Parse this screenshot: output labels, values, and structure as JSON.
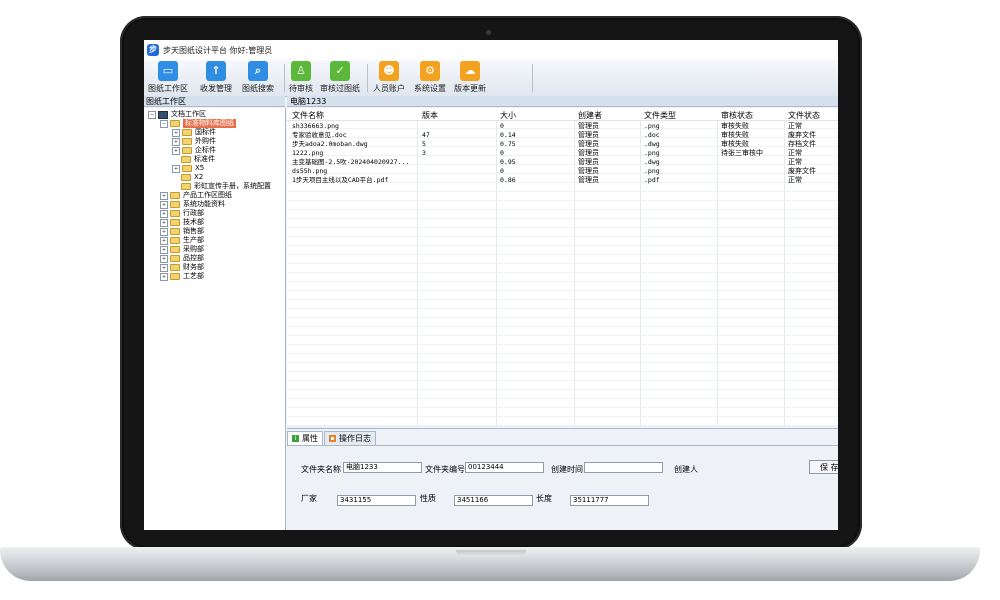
{
  "window": {
    "title": "步天图纸设计平台 你好:管理员"
  },
  "toolbar": {
    "buttons": [
      {
        "label": "图纸工作区",
        "icon": "monitor-icon",
        "color": "#2f8de4"
      },
      {
        "label": "收发管理",
        "icon": "upload-icon",
        "color": "#2f8de4"
      },
      {
        "label": "图纸搜索",
        "icon": "search-document-icon",
        "color": "#2f8de4"
      },
      {
        "label": "待审核",
        "icon": "stamp-icon",
        "color": "#5cb83a"
      },
      {
        "label": "审核过图纸",
        "icon": "approved-document-icon",
        "color": "#5cb83a"
      },
      {
        "label": "人员账户",
        "icon": "users-icon",
        "color": "#f3a21f"
      },
      {
        "label": "系统设置",
        "icon": "gear-icon",
        "color": "#f3a21f"
      },
      {
        "label": "版本更新",
        "icon": "cloud-update-icon",
        "color": "#f3a21f"
      }
    ]
  },
  "left_panel": {
    "header": "图纸工作区",
    "tree": [
      {
        "label": "文档工作区",
        "toggle": "−",
        "kind": "monitor"
      },
      {
        "label": "标准物料库图纸",
        "toggle": "−",
        "kind": "folder"
      },
      {
        "label": "国标件",
        "toggle": "+",
        "kind": "folder"
      },
      {
        "label": "外购件",
        "toggle": "+",
        "kind": "folder"
      },
      {
        "label": "企标件",
        "toggle": "+",
        "kind": "folder"
      },
      {
        "label": "标准件",
        "toggle": "",
        "kind": "folder"
      },
      {
        "label": "X5",
        "toggle": "+",
        "kind": "folder"
      },
      {
        "label": "X2",
        "toggle": "",
        "kind": "folder"
      },
      {
        "label": "彩虹宣传手册，系统配置",
        "toggle": "",
        "kind": "folder"
      },
      {
        "label": "产品工作区图纸",
        "toggle": "+",
        "kind": "folder"
      },
      {
        "label": "系统功能资料",
        "toggle": "+",
        "kind": "folder"
      },
      {
        "label": "行政部",
        "toggle": "+",
        "kind": "folder"
      },
      {
        "label": "技术部",
        "toggle": "+",
        "kind": "folder"
      },
      {
        "label": "销售部",
        "toggle": "+",
        "kind": "folder"
      },
      {
        "label": "生产部",
        "toggle": "+",
        "kind": "folder"
      },
      {
        "label": "采购部",
        "toggle": "+",
        "kind": "folder"
      },
      {
        "label": "品控部",
        "toggle": "+",
        "kind": "folder"
      },
      {
        "label": "财务部",
        "toggle": "+",
        "kind": "folder"
      },
      {
        "label": "工艺部",
        "toggle": "+",
        "kind": "folder"
      }
    ]
  },
  "right_panel": {
    "header": "电脑1233",
    "columns": [
      "文件名称",
      "版本",
      "大小",
      "创建者",
      "文件类型",
      "审核状态",
      "文件状态"
    ],
    "rows": [
      [
        "sh336663.png",
        "",
        "0",
        "管理员",
        ".png",
        "审核失败",
        "正常"
      ],
      [
        "专家验收意见.doc",
        "47",
        "0.14",
        "管理员",
        ".doc",
        "审核失败",
        "废弃文件"
      ],
      [
        "步天adoa2.0moban.dwg",
        "5",
        "0.75",
        "管理员",
        ".dwg",
        "审核失败",
        "存档文件"
      ],
      [
        "1222.png",
        "3",
        "0",
        "管理员",
        ".png",
        "待张三审核中",
        "正常"
      ],
      [
        "主变基础图-2.5吹-202404020927...",
        "",
        "0.95",
        "管理员",
        ".dwg",
        "",
        "正常"
      ],
      [
        "ds55h.png",
        "",
        "0",
        "管理员",
        ".png",
        "",
        "废弃文件"
      ],
      [
        "1步天项目主线以及CAD平台.pdf",
        "",
        "0.86",
        "管理员",
        ".pdf",
        "",
        "正常"
      ]
    ]
  },
  "properties": {
    "tabs": [
      "属性",
      "操作日志"
    ],
    "fields": {
      "folder_name_label": "文件夹名称",
      "folder_name_value": "电脑1233",
      "folder_no_label": "文件夹编号",
      "folder_no_value": "00123444",
      "created_time_label": "创建时间",
      "created_time_value": "",
      "creator_label": "创建人",
      "vendor_label": "厂家",
      "vendor_value": "3431155",
      "nature_label": "性质",
      "nature_value": "3451166",
      "length_label": "长度",
      "length_value": "35111777"
    },
    "save_label": "保 存"
  }
}
